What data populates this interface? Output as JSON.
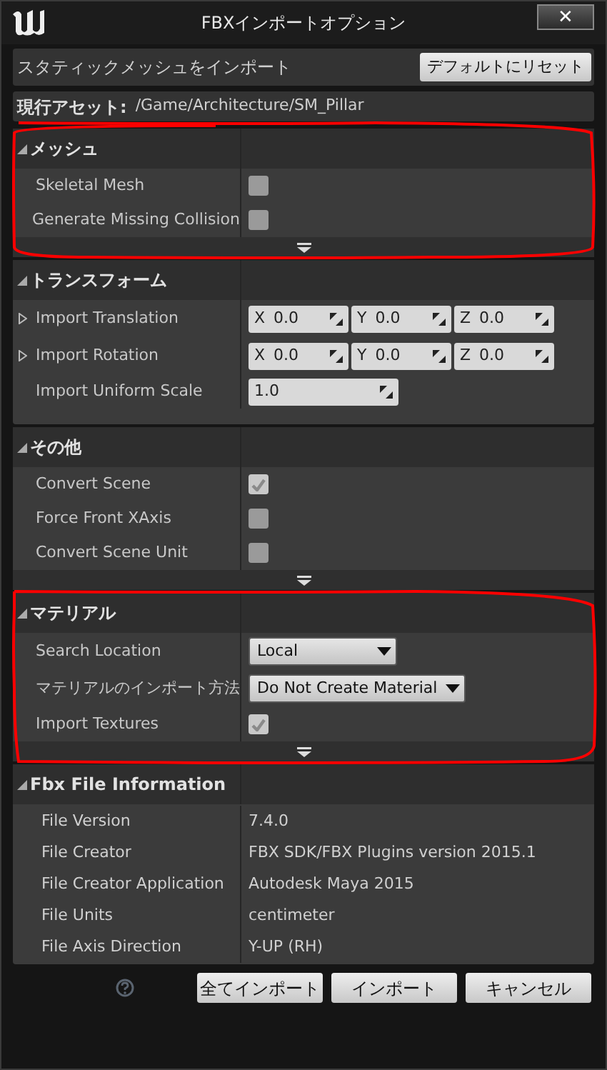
{
  "window": {
    "title": "FBXインポートオプション",
    "close": "✕"
  },
  "import_bar": {
    "label": "スタティックメッシュをインポート",
    "reset_button": "デフォルトにリセット"
  },
  "current_asset": {
    "label": "現行アセット:",
    "path": "/Game/Architecture/SM_Pillar"
  },
  "sections": [
    {
      "title": "メッシュ",
      "expanded": true,
      "more": true,
      "rows": [
        {
          "kind": "checkbox",
          "label": "Skeletal Mesh",
          "checked": false
        },
        {
          "kind": "checkbox",
          "label": "Generate Missing Collision",
          "checked": false
        }
      ]
    },
    {
      "title": "トランスフォーム",
      "expanded": true,
      "more": false,
      "rows": [
        {
          "kind": "vector",
          "label": "Import Translation",
          "expandable": true,
          "fields": [
            {
              "axis": "X",
              "value": "0.0"
            },
            {
              "axis": "Y",
              "value": "0.0"
            },
            {
              "axis": "Z",
              "value": "0.0"
            }
          ]
        },
        {
          "kind": "vector",
          "label": "Import Rotation",
          "expandable": true,
          "fields": [
            {
              "axis": "X",
              "value": "0.0"
            },
            {
              "axis": "Y",
              "value": "0.0"
            },
            {
              "axis": "Z",
              "value": "0.0"
            }
          ]
        },
        {
          "kind": "number",
          "label": "Import Uniform Scale",
          "value": "1.0"
        }
      ]
    },
    {
      "title": "その他",
      "expanded": true,
      "more": true,
      "rows": [
        {
          "kind": "checkbox",
          "label": "Convert Scene",
          "checked": true
        },
        {
          "kind": "checkbox",
          "label": "Force Front XAxis",
          "checked": false
        },
        {
          "kind": "checkbox",
          "label": "Convert Scene Unit",
          "checked": false
        }
      ]
    },
    {
      "title": "マテリアル",
      "expanded": true,
      "more": true,
      "rows": [
        {
          "kind": "dropdown",
          "label": "Search Location",
          "value": "Local"
        },
        {
          "kind": "dropdown",
          "label": "マテリアルのインポート方法",
          "value": "Do Not Create Material"
        },
        {
          "kind": "checkbox",
          "label": "Import Textures",
          "checked": true
        }
      ]
    },
    {
      "title": "Fbx File Information",
      "expanded": true,
      "more": false,
      "rows": [
        {
          "kind": "text",
          "label": "File Version",
          "value": "7.4.0"
        },
        {
          "kind": "text",
          "label": "File Creator",
          "value": "FBX SDK/FBX Plugins version 2015.1"
        },
        {
          "kind": "text",
          "label": "File Creator Application",
          "value": "Autodesk Maya 2015"
        },
        {
          "kind": "text",
          "label": "File Units",
          "value": "centimeter"
        },
        {
          "kind": "text",
          "label": "File Axis Direction",
          "value": "Y-UP (RH)"
        }
      ]
    }
  ],
  "buttons": [
    "全てインポート",
    "インポート",
    "キャンセル"
  ]
}
